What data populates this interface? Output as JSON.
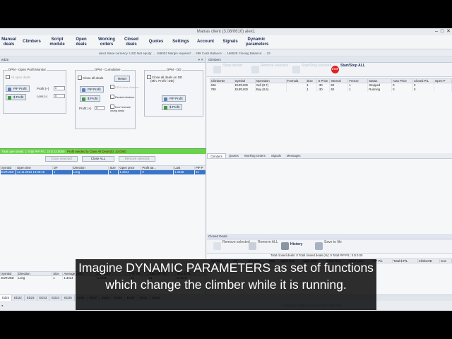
{
  "window": {
    "title": "Matras client (3.08/0610) alex1",
    "controls": [
      "–",
      "□",
      "✕"
    ]
  },
  "menu": [
    {
      "label": "Manual deals",
      "name": "menu-manual-deals"
    },
    {
      "label": "Climbers",
      "name": "menu-climbers"
    },
    {
      "label": "Script module",
      "name": "menu-script-module"
    },
    {
      "label": "Open deals",
      "name": "menu-open-deals"
    },
    {
      "label": "Working orders",
      "name": "menu-working-orders"
    },
    {
      "label": "Closed deals",
      "name": "menu-closed-deals"
    },
    {
      "label": "Quotes",
      "name": "menu-quotes"
    },
    {
      "label": "Settings",
      "name": "menu-settings"
    },
    {
      "label": "Account",
      "name": "menu-account"
    },
    {
      "label": "Signals",
      "name": "menu-signals"
    },
    {
      "label": "Dynamic parameters",
      "name": "menu-dynamic-parameters"
    }
  ],
  "infobar": "alex1   Base currency: USD   Net equity: ...   166032   Margin required: ...   288   Cash Balance: ...   166528   Closing Balance: ...   23",
  "left_panel": {
    "title": "ed25",
    "monitor_group": "DPM - Open Profit Monitor",
    "cumulative_group": "DPM - Cumulative",
    "dd_group": "DPM - DD",
    "monitor": {
      "all_open_label": "All open deals",
      "pip_profit": "PiP Profit",
      "dollar_profit": "$ Profit",
      "profit_label": "Profit (+)",
      "loss_label": "Loss (-)",
      "profit_value": "0",
      "loss_value": "0"
    },
    "cumulative": {
      "close_all": "Close all deals",
      "reset": "Reset",
      "pip_profit": "PiP Profit",
      "dollar_profit": "$ Profit",
      "option1": "DPM close climbers",
      "option2": "Restart climbers",
      "option3": "Don't include losing deals",
      "profit_label": "Profit (+)",
      "profit_value": "0"
    },
    "dd": {
      "close_all": "Close all deals on DD",
      "sub": "(Min. Profit / DD)",
      "pip_profit": "PiP Profit",
      "dollar_profit": "$ Profit"
    },
    "green_bar": "Total open deals: 1   Total PIP P/L: 22   $ 22.0000",
    "green_bar_warn": "Profit needed to Close All Deals(0): 10.0000",
    "buttons": {
      "close_selected": "Close selected",
      "close_all": "Close ALL",
      "remove_selected": "Remove selected"
    },
    "deals_table": {
      "columns": [
        "Symbol",
        "Open time",
        "DF",
        "Direction",
        "Size",
        "Open price",
        "Profit tar...",
        "Last",
        "PiP P"
      ],
      "rows": [
        [
          "EURUSD",
          "12.11.2013 13:30:46",
          "1",
          "Long",
          "1",
          "1.3414",
          "0",
          "1.3435",
          "21"
        ]
      ]
    },
    "summary_table": {
      "columns": [
        "Symbol",
        "Direction",
        "Size",
        "Average price",
        "Last price",
        "PiP P/L",
        "Total PiP P/L",
        "Total $ P/L"
      ],
      "rows": [
        [
          "EURUSD",
          "Long",
          "1",
          "1.3414",
          "1.3435",
          "21",
          "21",
          "22.80 $"
        ]
      ]
    }
  },
  "climbers_panel": {
    "title": "Climbers",
    "toolbar": {
      "show_details": "Show details",
      "remove_selected": "Remove selected",
      "start_stop_selected": "Start/Stop selected",
      "start_stop_all": "Start/Stop ALL",
      "stop_icon_text": "STOP"
    },
    "columns": [
      "ClimberID",
      "Symbol",
      "Operation",
      "Formula",
      "Size",
      "S Price",
      "Interval",
      "Freeze",
      "Status",
      "Auto Price",
      "Closed P/L",
      "Open P"
    ],
    "rows": [
      [
        "626",
        "EURUSD",
        "Sell (8.7)",
        "",
        "1",
        "-30",
        "50",
        "1",
        "Stopped",
        "0",
        "0",
        ""
      ],
      [
        "780",
        "EURUSD",
        "Buy (0.6)",
        "",
        "1",
        "-30",
        "50",
        "1",
        "Running",
        "0",
        "0",
        ""
      ]
    ],
    "tabs": [
      "Climbers",
      "Quotes",
      "Working Orders",
      "Signals",
      "Messages"
    ]
  },
  "closed_panel": {
    "title": "Closed Deals",
    "toolbar": {
      "remove_selected": "Remove selected",
      "remove_all": "Remove ALL",
      "history": "History",
      "save_to_file": "Save to file"
    },
    "summary": "Total closed deals: 0   Total closed deals (%): 0   Total PiP P/L: 0   $ 0.00",
    "columns": [
      "Symbol",
      "DF",
      "Direction",
      "Size",
      "Open time",
      "Open price",
      "Close time",
      "Close price",
      "PiP P/L",
      "Total $ P/L",
      "ClimberID",
      "Cos"
    ]
  },
  "bottom_tabs": [
    "Ed25",
    "ED22",
    "ED23",
    "ED23",
    "ED24",
    "ED25",
    "ED26",
    "ED27",
    "ED28",
    "ED29",
    "ED30",
    "ED31",
    "ED32"
  ],
  "footer": {
    "left": "●",
    "right": "Connected   Market Session: Open   Real Time"
  },
  "caption": "Imagine DYNAMIC PARAMETERS as set of functions which change the climber while it is running."
}
